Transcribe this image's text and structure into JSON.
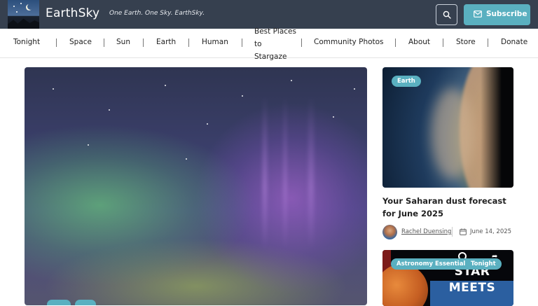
{
  "header": {
    "site_name": "EarthSky",
    "tagline": "One Earth. One Sky. EarthSky.",
    "subscribe_label": "Subscribe",
    "search_icon": "search-icon",
    "mail_icon": "mail-icon"
  },
  "nav": {
    "items": [
      {
        "label": "Tonight"
      },
      {
        "label": "Space"
      },
      {
        "label": "Sun"
      },
      {
        "label": "Earth"
      },
      {
        "label": "Human"
      },
      {
        "label": "Best Places to Stargaze"
      },
      {
        "label": "Community Photos"
      },
      {
        "label": "About"
      },
      {
        "label": "Store"
      },
      {
        "label": "Donate"
      }
    ]
  },
  "sidebar": {
    "card1": {
      "tag": "Earth",
      "title": "Your Saharan dust forecast for June 2025",
      "author": "Rachel Duensing",
      "date": "June 14, 2025"
    },
    "card2": {
      "tags": [
        "Astronomy Essentials",
        "Tonight"
      ],
      "image_text": "STAR MEETS"
    }
  },
  "colors": {
    "header_bg": "#36404f",
    "accent": "#5ab0c0",
    "nav_text": "#222222"
  }
}
